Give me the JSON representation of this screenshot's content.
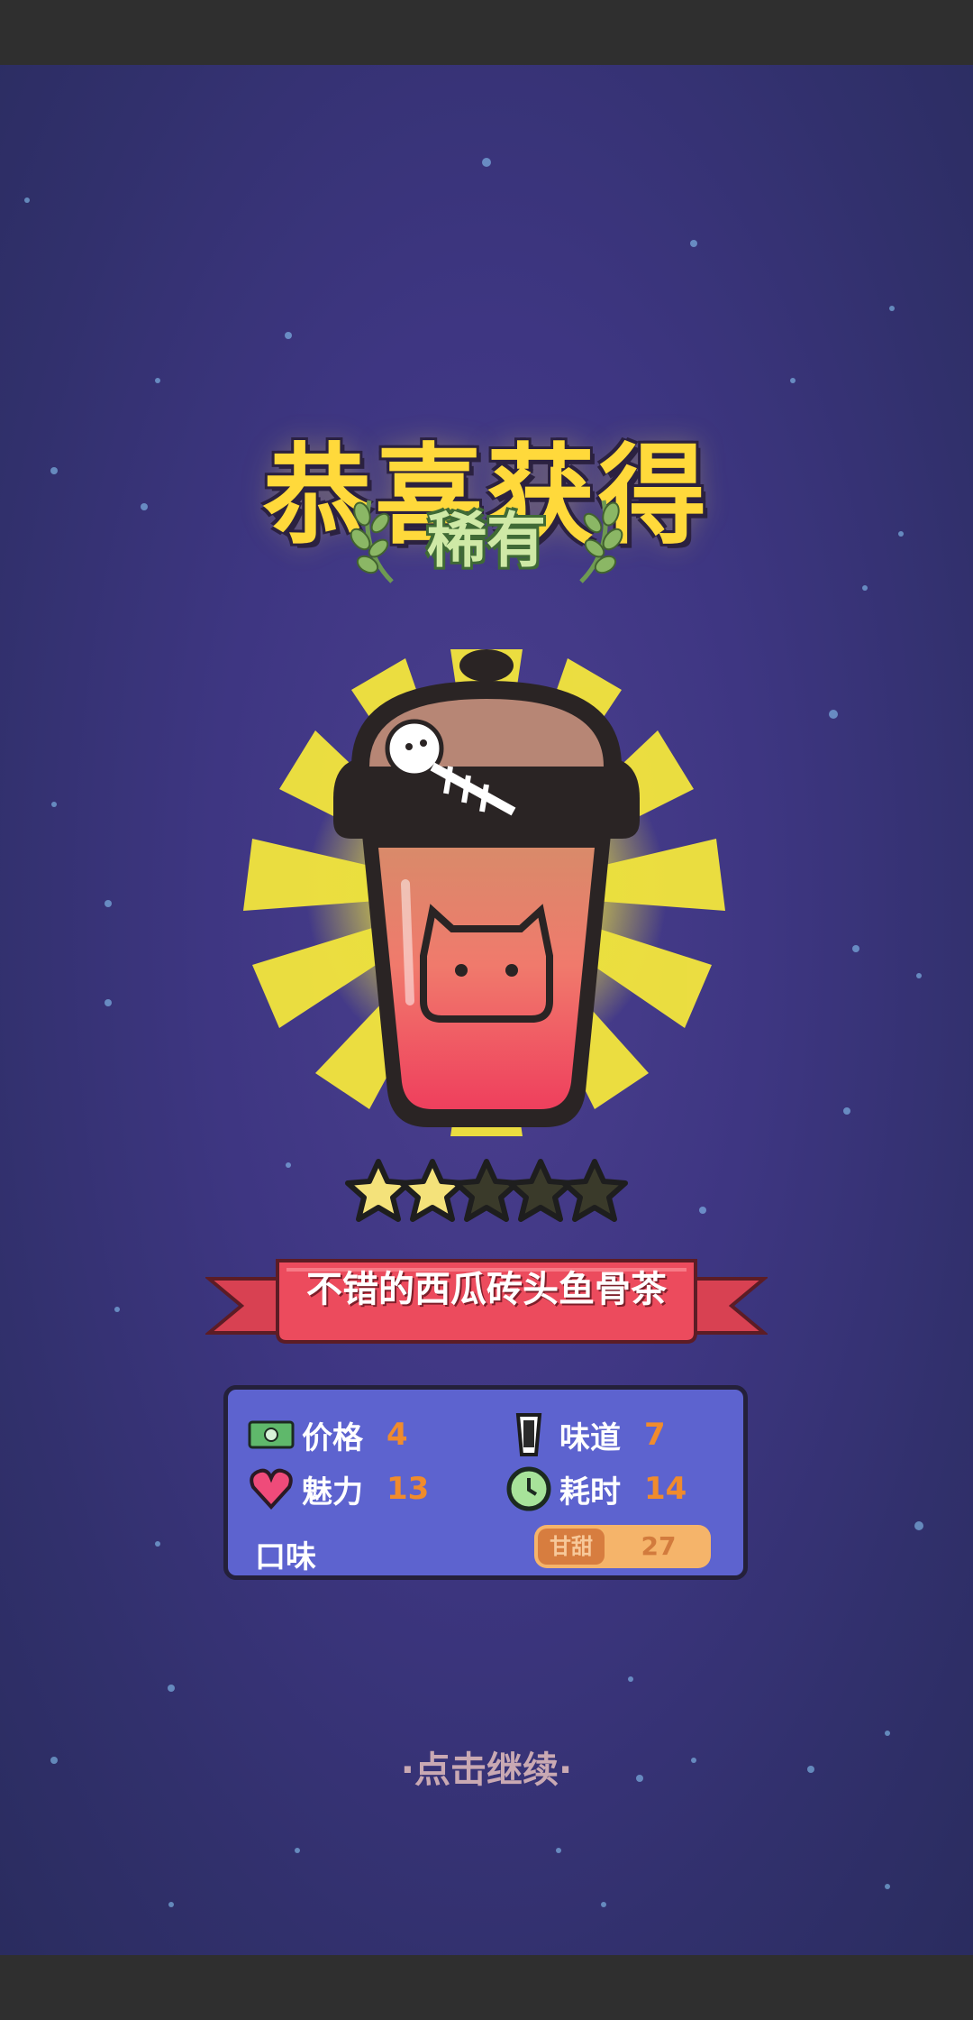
{
  "reward": {
    "title": "恭喜获得",
    "rarity": "稀有",
    "item_name": "不错的西瓜砖头鱼骨茶",
    "rating": {
      "filled": 2,
      "total": 5
    }
  },
  "stats": {
    "price_label": "价格",
    "price_value": "4",
    "taste_label": "味道",
    "taste_value": "7",
    "charm_label": "魅力",
    "charm_value": "13",
    "time_label": "耗时",
    "time_value": "14",
    "flavor_label": "口味",
    "flavor_tag": "甘甜",
    "flavor_value": "27"
  },
  "continue_hint": "·点击继续·",
  "colors": {
    "title": "#ffd93b",
    "rarity": "#cfe9a6",
    "panel": "#5d63cf",
    "stat_value": "#f08b2c",
    "banner": "#e8475a",
    "star_filled": "#f4e27a",
    "star_empty": "#3a3a2a"
  },
  "icons": [
    "money-icon",
    "heart-icon",
    "cup-icon",
    "clock-icon",
    "laurel-icon",
    "star-icon"
  ]
}
